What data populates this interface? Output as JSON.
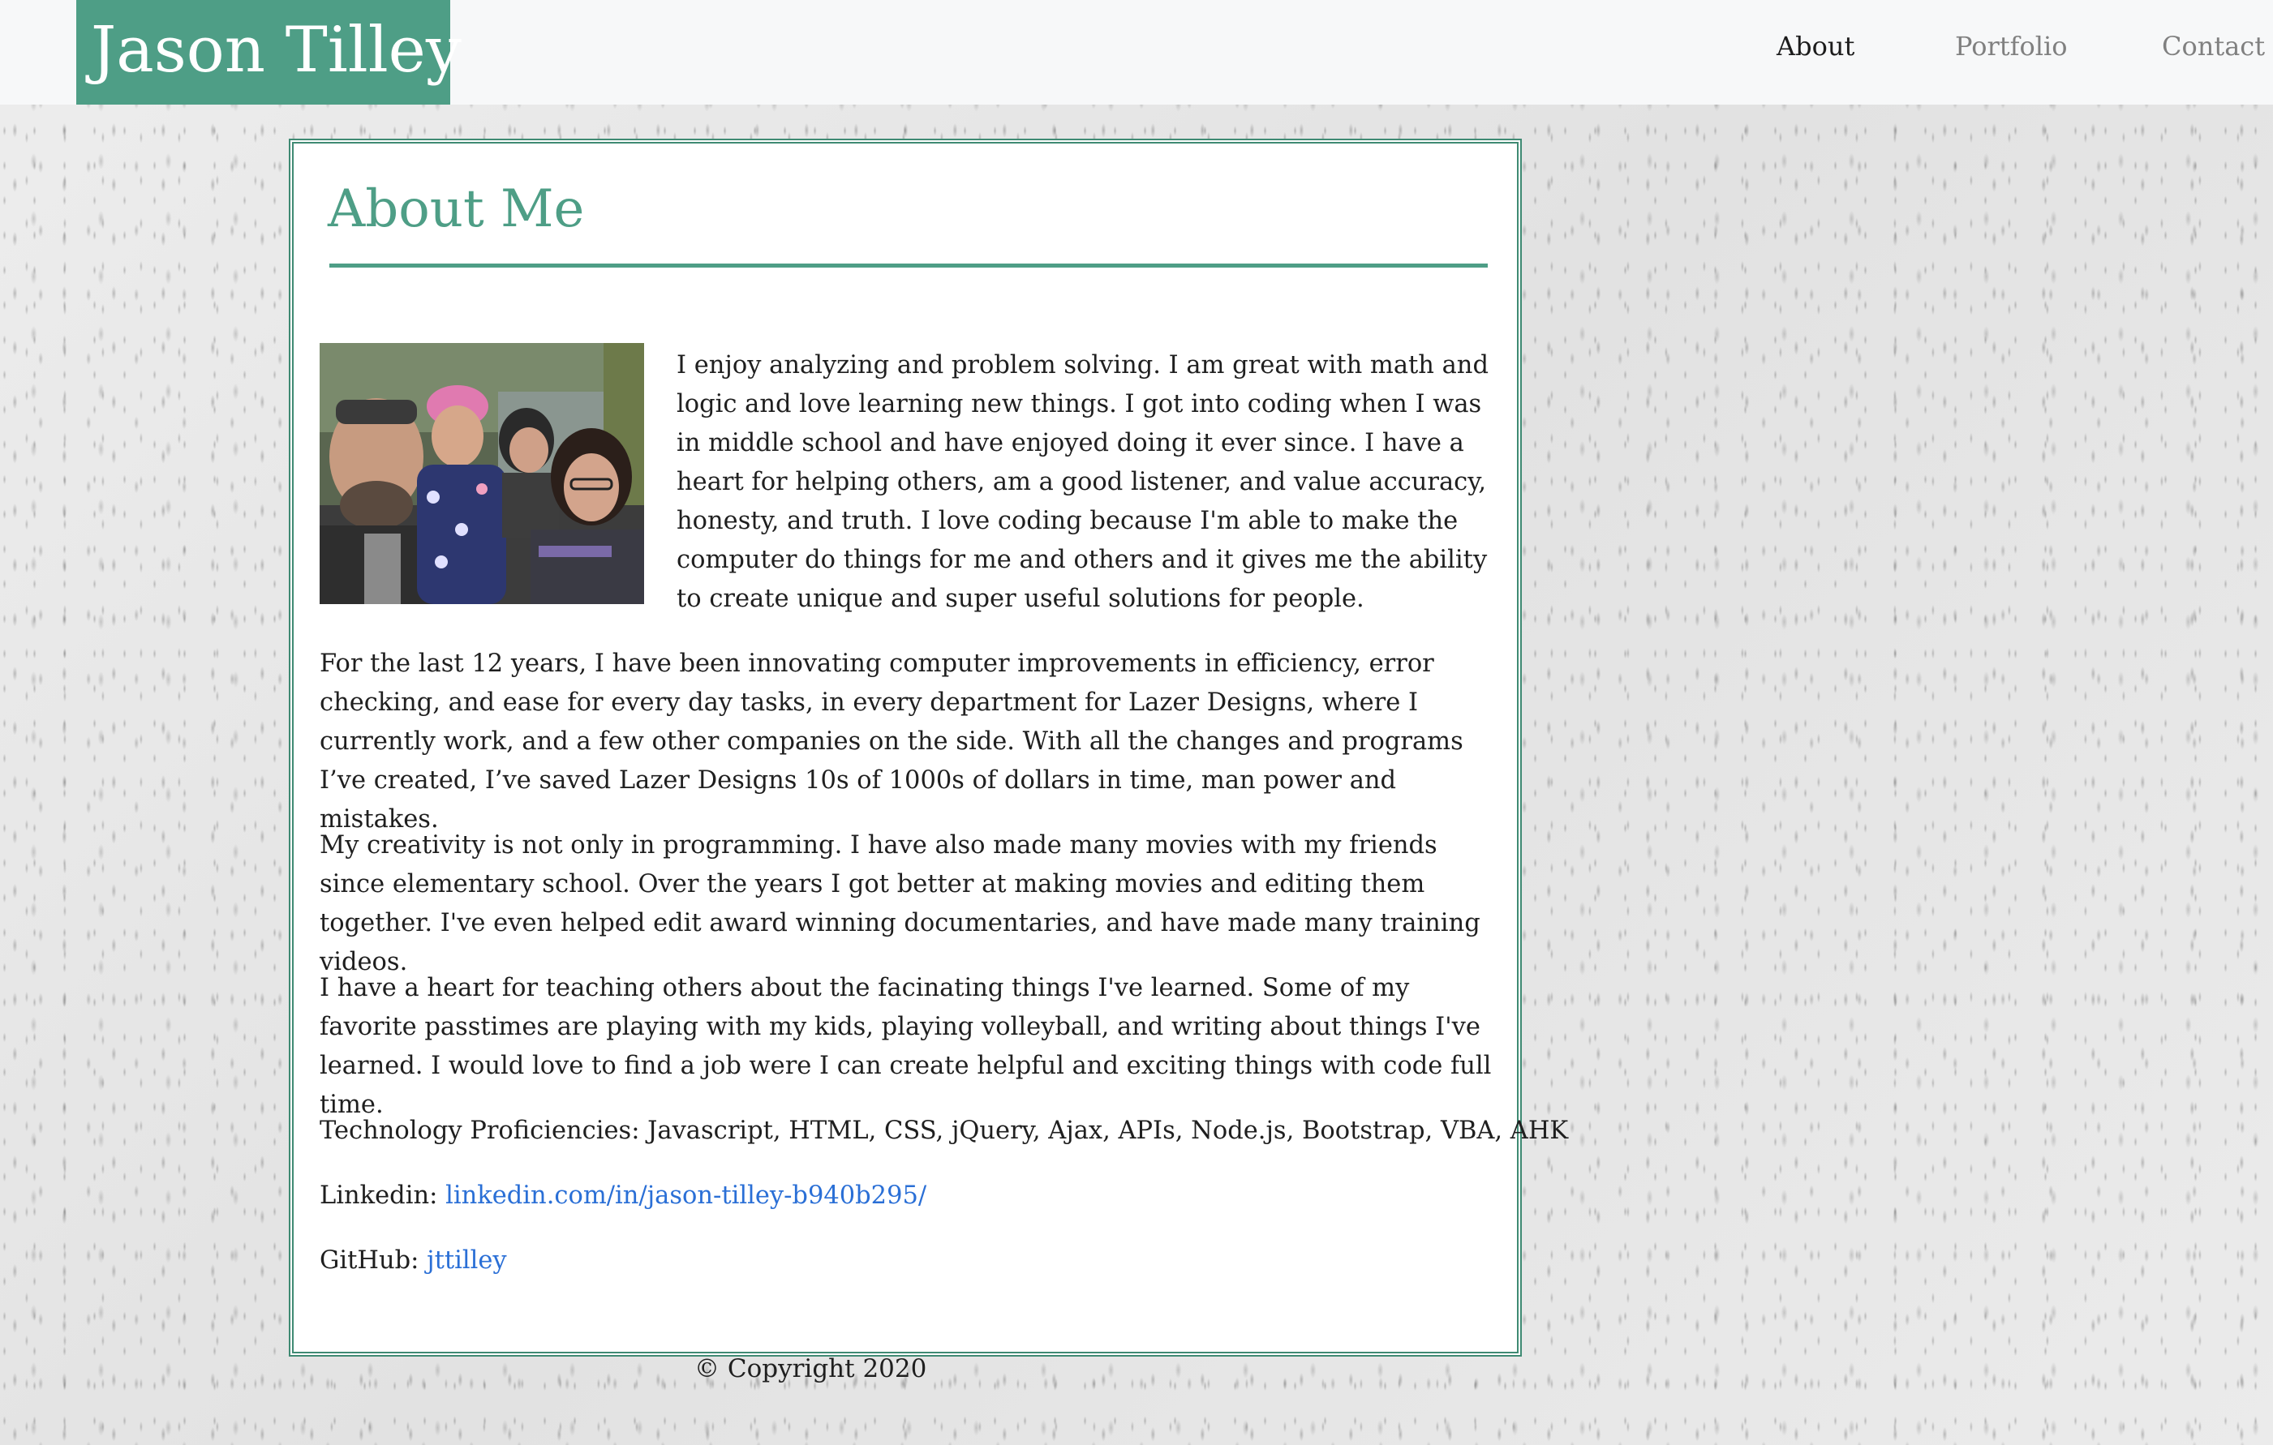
{
  "navbar": {
    "brand": "Jason Tilley",
    "links": [
      {
        "label": "About",
        "active": true
      },
      {
        "label": "Portfolio",
        "active": false
      },
      {
        "label": "Contact",
        "active": false
      }
    ]
  },
  "about": {
    "title": "About Me",
    "paragraphs": [
      "I enjoy analyzing and problem solving. I am great with math and logic and love learning new things. I got into coding when I was in middle school and have enjoyed doing it ever since. I have a heart for helping others, am a good listener, and value accuracy, honesty, and truth. I love coding because I'm able to make the computer do things for me and others and it gives me the ability to create unique and super useful solutions for people.",
      "For the last 12 years, I have been innovating computer improvements in efficiency, error checking, and ease for every day tasks, in every department for Lazer Designs, where I currently work, and a few other companies on the side. With all the changes and programs I’ve created, I’ve saved Lazer Designs 10s of 1000s of dollars in time, man power and mistakes.",
      "My creativity is not only in programming. I have also made many movies with my friends since elementary school. Over the years I got better at making movies and editing them together. I've even helped edit award winning documentaries, and have made many training videos.",
      "I have a heart for teaching others about the facinating things I've learned. Some of my favorite passtimes are playing with my kids, playing volleyball, and writing about things I've learned. I would love to find a job were I can create helpful and exciting things with code full time.",
      "Technology Proficiencies: Javascript, HTML, CSS, jQuery, Ajax, APIs, Node.js, Bootstrap, VBA, AHK"
    ],
    "linkedin": {
      "label": "Linkedin:",
      "link_text": "linkedin.com/in/jason-tilley-b940b295/"
    },
    "github": {
      "label": "GitHub:",
      "link_text": "jttilley"
    }
  },
  "footer": {
    "copyright": "© Copyright 2020"
  },
  "colors": {
    "accent": "#4e9e86",
    "card_border": "#3f8a73",
    "link": "#2a6fd6",
    "nav_bg": "#f7f8f9"
  },
  "icons": {
    "photo": "family-photo"
  }
}
